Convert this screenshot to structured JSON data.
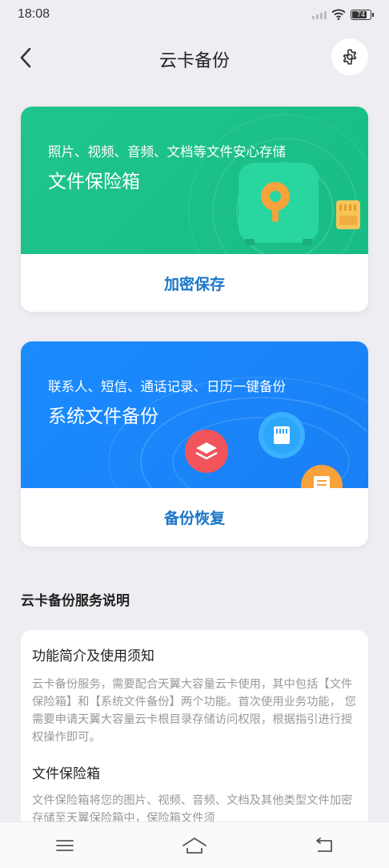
{
  "status_bar": {
    "time": "18:08",
    "battery": "74"
  },
  "header": {
    "title": "云卡备份"
  },
  "vault_card": {
    "subtitle": "照片、视频、音频、文档等文件安心存储",
    "title": "文件保险箱",
    "action": "加密保存",
    "color": "#1fc58d"
  },
  "backup_card": {
    "subtitle": "联系人、短信、通话记录、日历一键备份",
    "title": "系统文件备份",
    "action": "备份恢复",
    "color": "#1a8cff"
  },
  "section": {
    "title": "云卡备份服务说明"
  },
  "info": {
    "heading": "功能简介及使用须知",
    "text": "云卡备份服务，需要配合天翼大容量云卡使用，其中包括【文件保险箱】和【系统文件备份】两个功能。首次使用业务功能， 您需要申请天翼大容量云卡根目录存储访问权限，根据指引进行授权操作即可。",
    "heading_2": "文件保险箱",
    "text_2": "文件保险箱将您的图片、视频、音频、文档及其他类型文件加密存储至天翼保险箱中，保险箱文件须"
  },
  "colors": {
    "accent": "#1976c9"
  }
}
